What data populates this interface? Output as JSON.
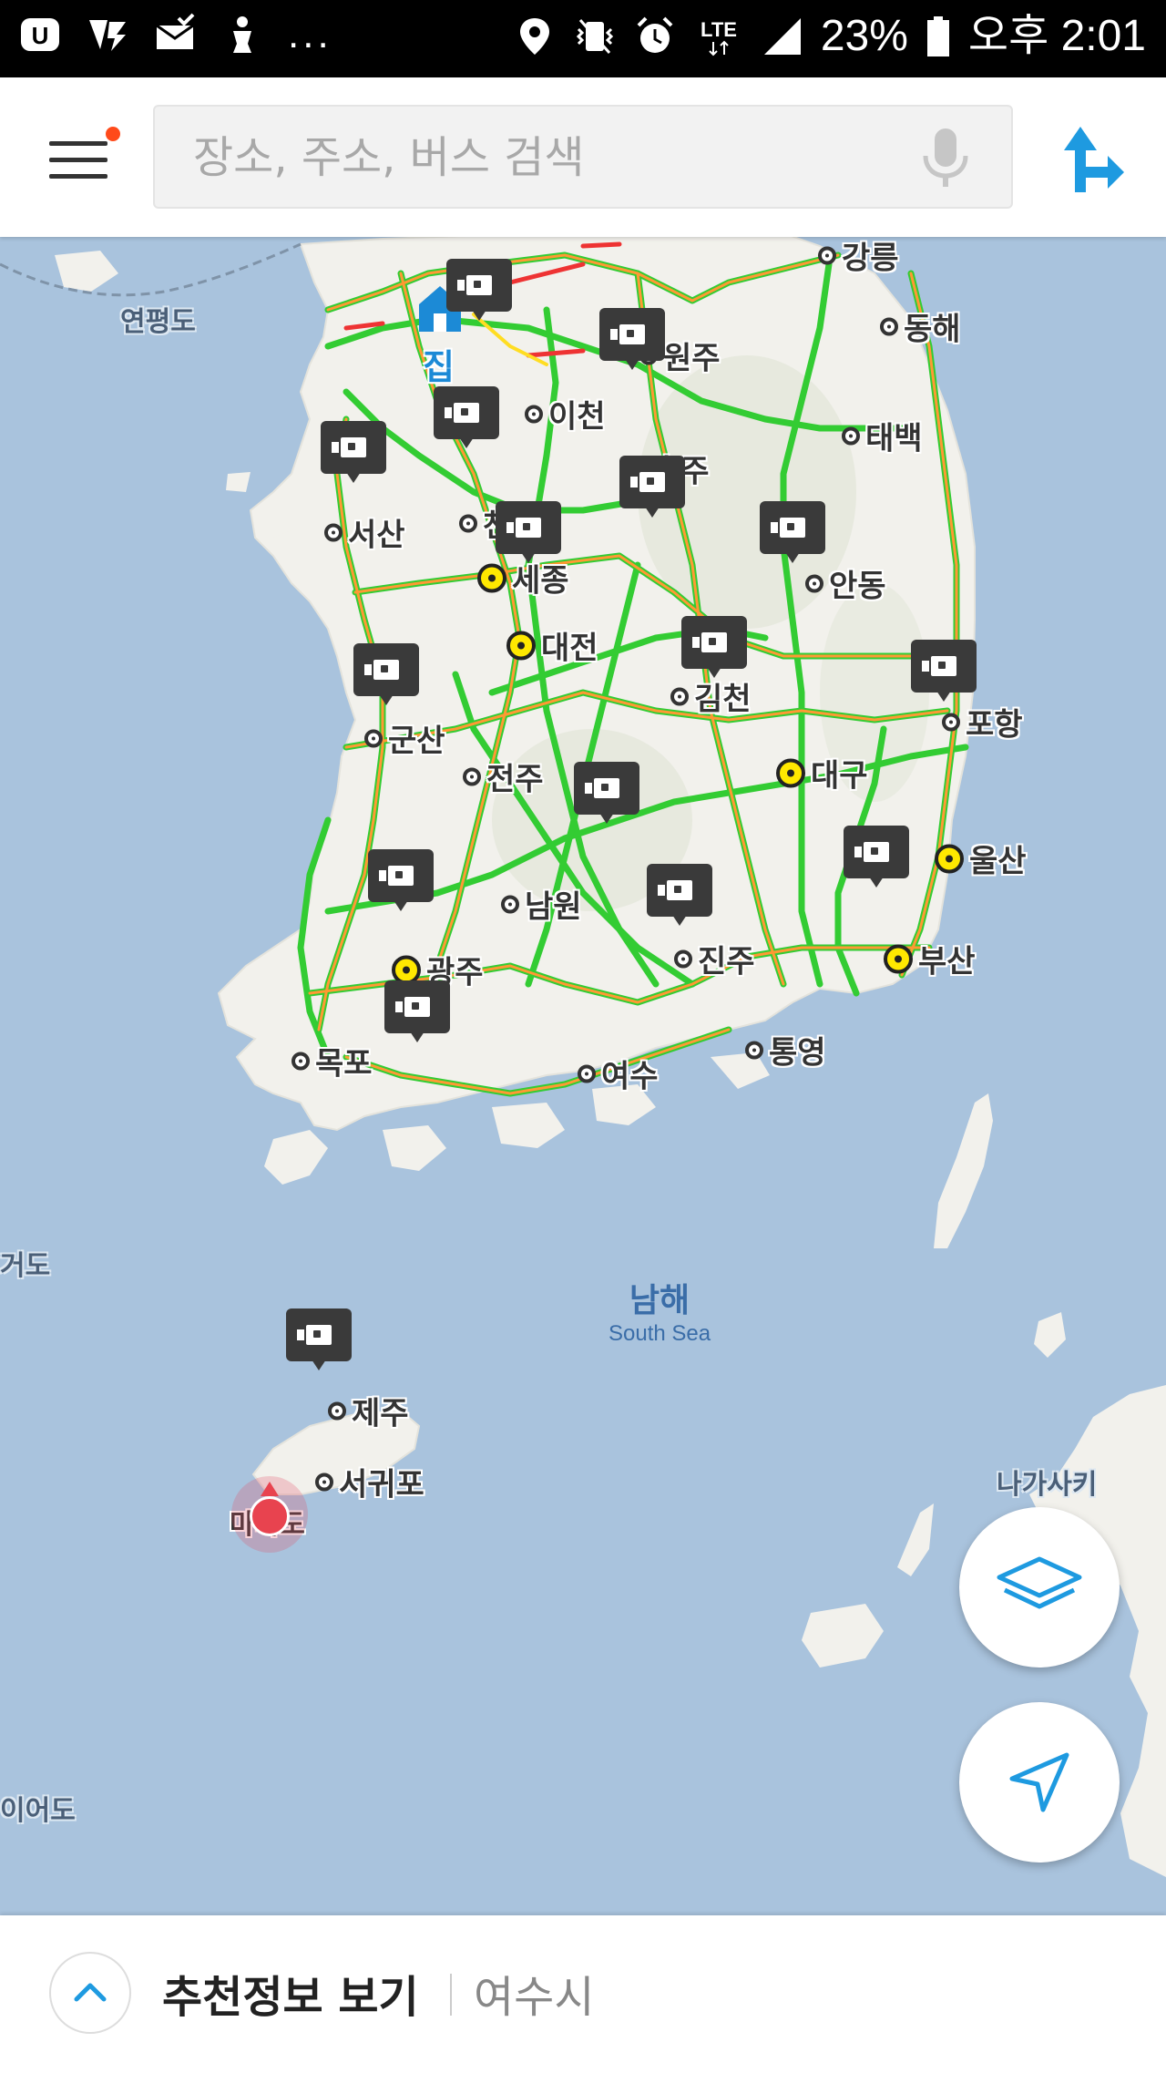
{
  "status_bar": {
    "left_icons": [
      "u-plus-icon",
      "v3-icon",
      "mail-icon",
      "notification-icon"
    ],
    "more": "...",
    "right_icons": [
      "location-icon",
      "vibrate-icon",
      "alarm-icon",
      "lte-icon",
      "signal-icon"
    ],
    "network": "LTE",
    "battery": "23%",
    "time": "오후 2:01"
  },
  "header": {
    "menu_icon": "hamburger-menu-icon",
    "search_placeholder": "장소, 주소, 버스 검색",
    "mic_icon": "microphone-icon",
    "route_icon": "directions-icon"
  },
  "map": {
    "home_label": "집",
    "sea": {
      "ko": "남해",
      "en": "South Sea"
    },
    "regions": [
      "연평도",
      "거도",
      "이어도",
      "나가사키"
    ],
    "cities": [
      "강릉",
      "동해",
      "원주",
      "이천",
      "태백",
      "충주",
      "서산",
      "천안",
      "세종",
      "안동",
      "대전",
      "김천",
      "포항",
      "군산",
      "전주",
      "대구",
      "울산",
      "남원",
      "광주",
      "진주",
      "부산",
      "목포",
      "여수",
      "통영",
      "제주",
      "서귀포",
      "마라도"
    ],
    "major_cities": [
      "세종",
      "대전",
      "대구",
      "울산",
      "광주",
      "부산"
    ],
    "traffic_colors": {
      "smooth": "#33cc33",
      "slow": "#ff9933",
      "congested": "#ee3333"
    }
  },
  "controls": {
    "layers_icon": "layers-icon",
    "locate_icon": "navigation-arrow-icon"
  },
  "bottom_bar": {
    "expand_icon": "chevron-up-icon",
    "recommend_label": "추천정보 보기",
    "location": "여수시"
  }
}
